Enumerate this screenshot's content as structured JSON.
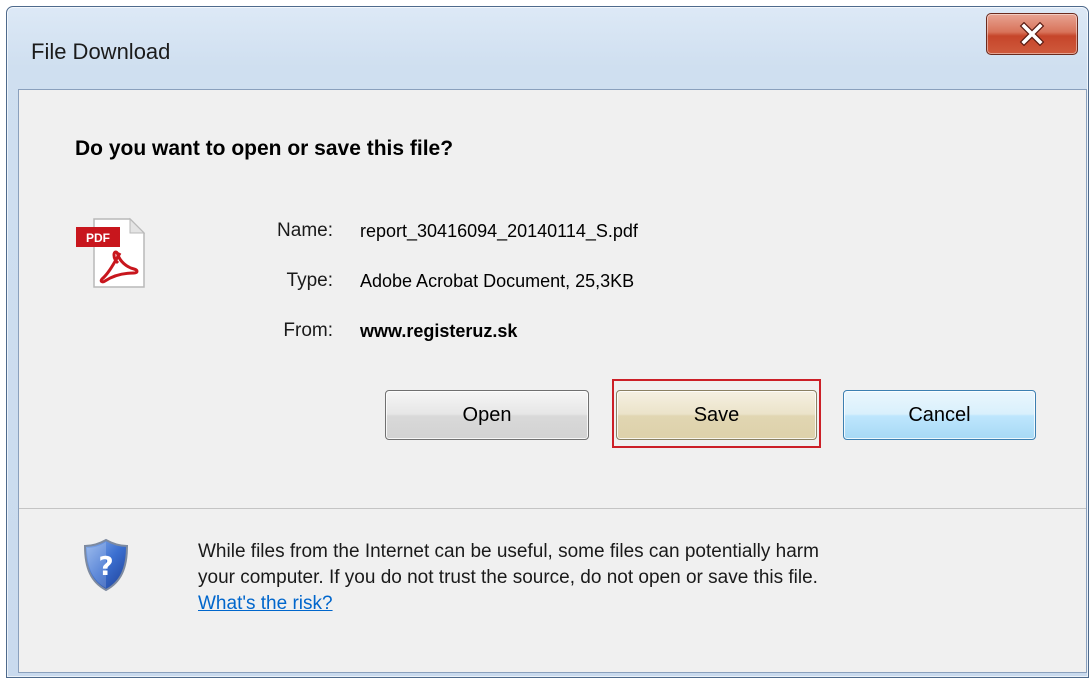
{
  "window": {
    "title": "File Download",
    "close_symbol": "X"
  },
  "dialog": {
    "question": "Do you want to open or save this file?",
    "file_icon": "pdf-file-icon",
    "file_icon_badge": "PDF",
    "fields": {
      "name_label": "Name:",
      "name_value": "report_30416094_20140114_S.pdf",
      "type_label": "Type:",
      "type_value": "Adobe Acrobat Document, 25,3KB",
      "from_label": "From:",
      "from_value": "www.registeruz.sk"
    },
    "buttons": {
      "open": "Open",
      "save": "Save",
      "cancel": "Cancel"
    },
    "highlight_color": "#cc1f27"
  },
  "warning": {
    "icon": "shield-question-icon",
    "line1": "While files from the Internet can be useful, some files can potentially harm",
    "line2": "your computer. If you do not trust the source, do not open or save this file.",
    "link": "What's the risk?"
  }
}
